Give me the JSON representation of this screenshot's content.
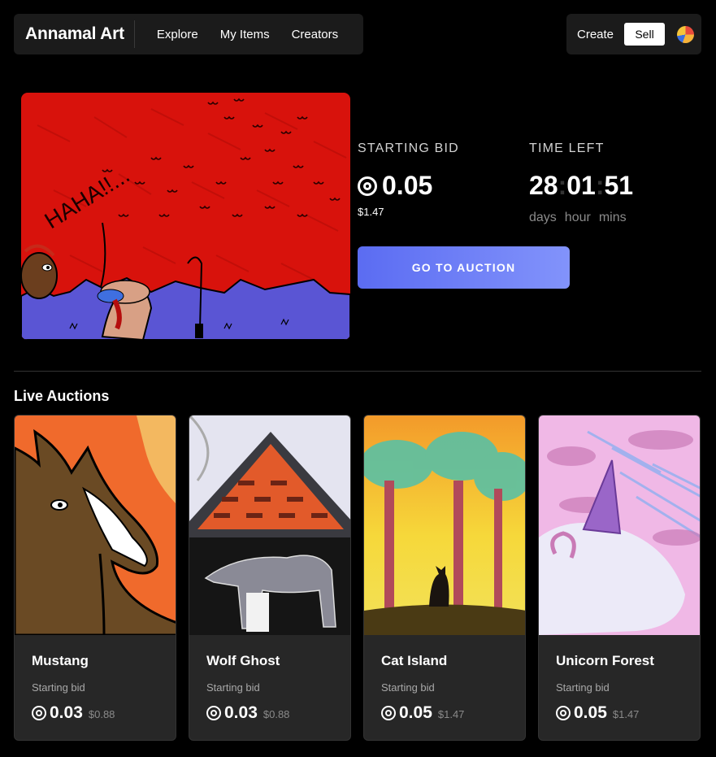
{
  "header": {
    "brand": "Annamal Art",
    "nav": [
      "Explore",
      "My Items",
      "Creators"
    ],
    "create_label": "Create",
    "sell_label": "Sell"
  },
  "hero": {
    "bid_label": "STARTING BID",
    "price_eth": "0.05",
    "price_usd": "$1.47",
    "time_label": "TIME LEFT",
    "timer": {
      "days": "28",
      "hours": "01",
      "mins": "51"
    },
    "units": [
      "days",
      "hour",
      "mins"
    ],
    "cta_label": "GO TO AUCTION",
    "art_text": "HAHA!!..."
  },
  "auctions": {
    "title": "Live Auctions",
    "items": [
      {
        "title": "Mustang",
        "sub": "Starting bid",
        "eth": "0.03",
        "usd": "$0.88"
      },
      {
        "title": "Wolf Ghost",
        "sub": "Starting bid",
        "eth": "0.03",
        "usd": "$0.88"
      },
      {
        "title": "Cat Island",
        "sub": "Starting bid",
        "eth": "0.05",
        "usd": "$1.47"
      },
      {
        "title": "Unicorn Forest",
        "sub": "Starting bid",
        "eth": "0.05",
        "usd": "$1.47"
      }
    ]
  },
  "colors": {
    "accent_start": "#5b6cf2",
    "accent_end": "#8293fb",
    "card_bg": "#272727"
  }
}
